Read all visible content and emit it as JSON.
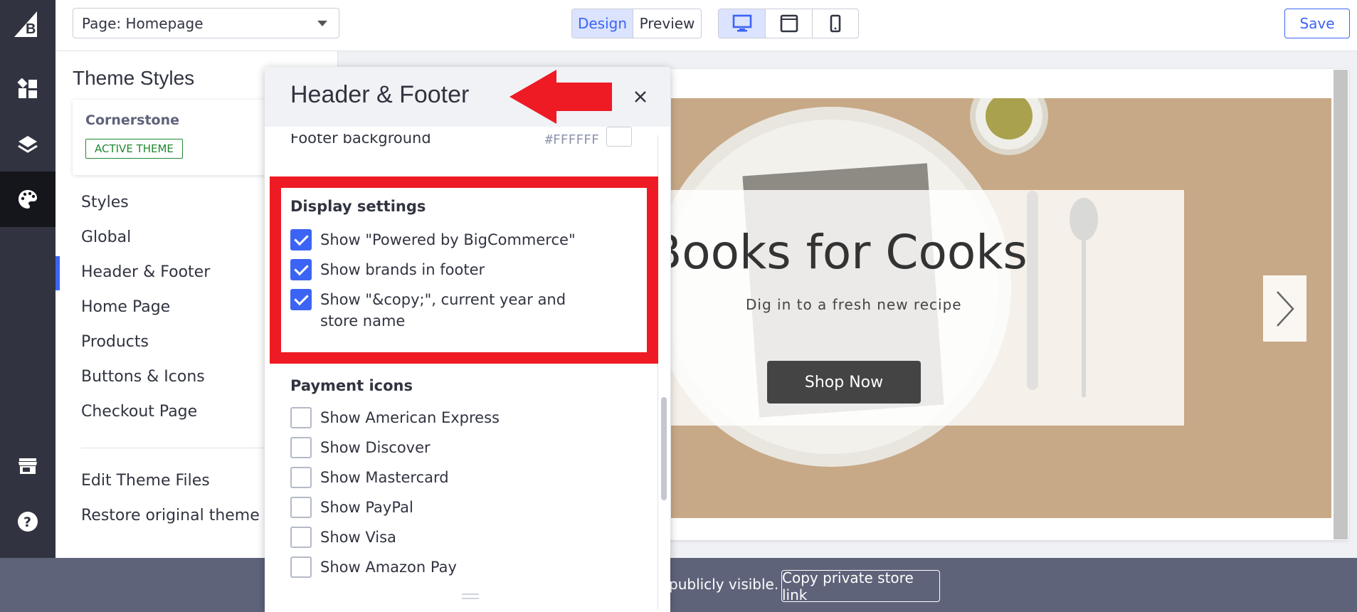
{
  "rail": {
    "icons": [
      "bigcommerce-logo",
      "dashboard-icon",
      "layers-icon",
      "palette-icon",
      "storefront-icon",
      "help-icon"
    ]
  },
  "topbar": {
    "page_select": "Page: Homepage",
    "view_modes": [
      "Design",
      "Preview"
    ],
    "active_view_mode": "Design",
    "devices": [
      "desktop-icon",
      "tablet-icon",
      "mobile-icon"
    ],
    "active_device": "desktop-icon",
    "save_label": "Save"
  },
  "sidebar": {
    "title": "Theme Styles",
    "theme_name": "Cornerstone",
    "active_badge": "ACTIVE THEME",
    "nav": [
      "Styles",
      "Global",
      "Header & Footer",
      "Home Page",
      "Products",
      "Buttons & Icons",
      "Checkout Page"
    ],
    "active_nav": "Header & Footer",
    "links": [
      "Edit Theme Files",
      "Restore original theme sty"
    ]
  },
  "panel": {
    "title": "Header & Footer",
    "footer_background": {
      "label": "Footer background",
      "value": "#FFFFFF"
    },
    "display_settings": {
      "title": "Display settings",
      "options": [
        {
          "label": "Show \"Powered by BigCommerce\"",
          "checked": true
        },
        {
          "label": "Show brands in footer",
          "checked": true
        },
        {
          "label": "Show \"&copy;\", current year and store name",
          "checked": true
        }
      ]
    },
    "payment_icons": {
      "title": "Payment icons",
      "options": [
        {
          "label": "Show American Express",
          "checked": false
        },
        {
          "label": "Show Discover",
          "checked": false
        },
        {
          "label": "Show Mastercard",
          "checked": false
        },
        {
          "label": "Show PayPal",
          "checked": false
        },
        {
          "label": "Show Visa",
          "checked": false
        },
        {
          "label": "Show Amazon Pay",
          "checked": false
        }
      ]
    }
  },
  "preview": {
    "hero_title": "Books for Cooks",
    "hero_subtitle": "Dig in to a fresh new recipe",
    "cta_label": "Shop Now"
  },
  "bottom_bar": {
    "text": "publicly visible.",
    "button_label": "Copy private store link"
  },
  "colors": {
    "rail": "#313440",
    "accent": "#3c64f4",
    "highlight": "#ee1b24",
    "hero_bg": "#c7a987",
    "bottom_bar": "#5e637a"
  }
}
